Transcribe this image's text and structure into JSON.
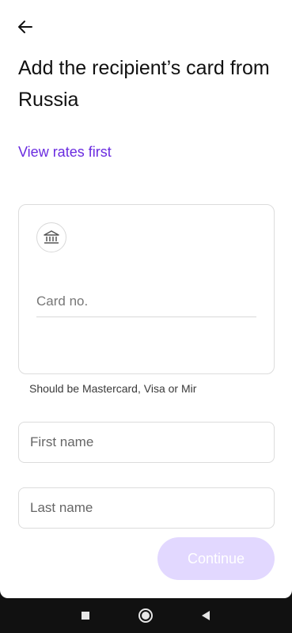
{
  "header": {
    "back_icon": "arrow-left-icon",
    "title": "Add the recipient’s card from Russia"
  },
  "links": {
    "view_rates": "View rates first"
  },
  "card": {
    "icon": "bank-icon",
    "card_no_placeholder": "Card no.",
    "hint": "Should be Mastercard, Visa or Mir"
  },
  "fields": {
    "first_name_placeholder": "First name",
    "last_name_placeholder": "Last name"
  },
  "actions": {
    "continue_label": "Continue"
  },
  "navbar": {
    "recent_icon": "square-recents-icon",
    "home_icon": "circle-home-icon",
    "back_icon": "triangle-back-icon"
  },
  "colors": {
    "accent": "#6a2be0",
    "continue_disabled_bg": "#e2d8ff"
  }
}
